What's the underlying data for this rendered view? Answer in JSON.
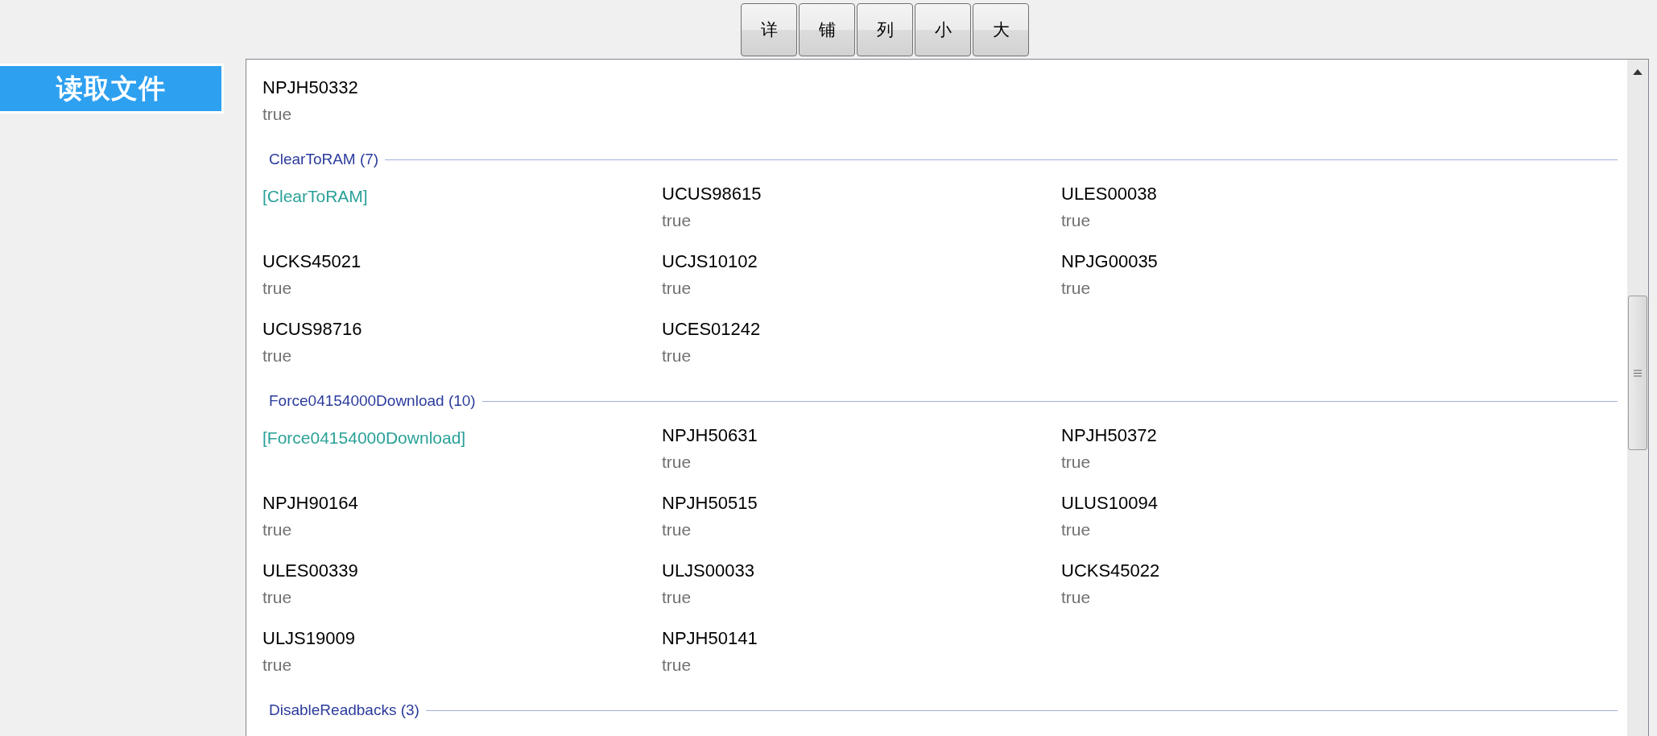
{
  "toolbar": {
    "buttons": [
      "详",
      "铺",
      "列",
      "小",
      "大"
    ]
  },
  "sidebar": {
    "button": "读取文件"
  },
  "list": {
    "lead_items": [
      {
        "name": "NPJH50332",
        "value": "true"
      }
    ],
    "groups": [
      {
        "header": "ClearToRAM (7)",
        "cells": [
          {
            "kind": "tag",
            "text": "[ClearToRAM]"
          },
          {
            "kind": "item",
            "name": "UCUS98615",
            "value": "true"
          },
          {
            "kind": "item",
            "name": "ULES00038",
            "value": "true"
          },
          {
            "kind": "item",
            "name": "UCKS45021",
            "value": "true"
          },
          {
            "kind": "item",
            "name": "UCJS10102",
            "value": "true"
          },
          {
            "kind": "item",
            "name": "NPJG00035",
            "value": "true"
          },
          {
            "kind": "item",
            "name": "UCUS98716",
            "value": "true"
          },
          {
            "kind": "item",
            "name": "UCES01242",
            "value": "true"
          }
        ]
      },
      {
        "header": "Force04154000Download (10)",
        "cells": [
          {
            "kind": "tag",
            "text": "[Force04154000Download]"
          },
          {
            "kind": "item",
            "name": "NPJH50631",
            "value": "true"
          },
          {
            "kind": "item",
            "name": "NPJH50372",
            "value": "true"
          },
          {
            "kind": "item",
            "name": "NPJH90164",
            "value": "true"
          },
          {
            "kind": "item",
            "name": "NPJH50515",
            "value": "true"
          },
          {
            "kind": "item",
            "name": "ULUS10094",
            "value": "true"
          },
          {
            "kind": "item",
            "name": "ULES00339",
            "value": "true"
          },
          {
            "kind": "item",
            "name": "ULJS00033",
            "value": "true"
          },
          {
            "kind": "item",
            "name": "UCKS45022",
            "value": "true"
          },
          {
            "kind": "item",
            "name": "ULJS19009",
            "value": "true"
          },
          {
            "kind": "item",
            "name": "NPJH50141",
            "value": "true"
          }
        ]
      },
      {
        "header": "DisableReadbacks (3)"
      }
    ]
  }
}
